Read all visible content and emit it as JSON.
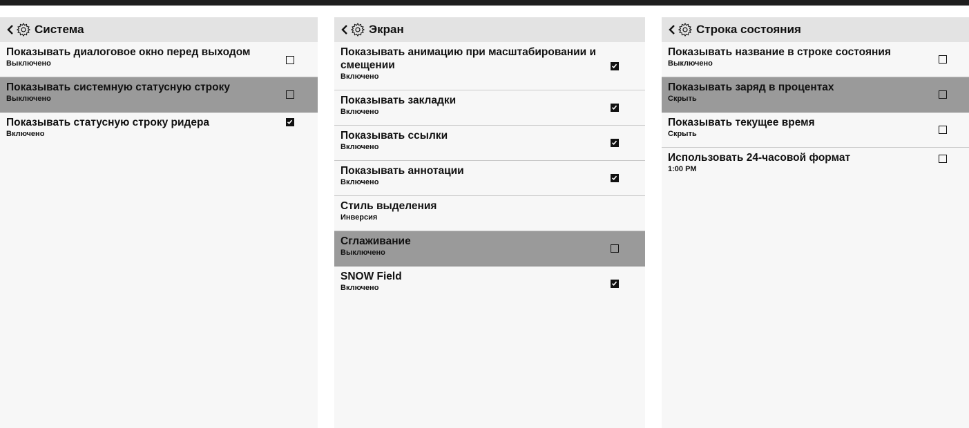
{
  "icons": {
    "back": "chevron-left-icon",
    "settings": "gear-icon",
    "checkbox_checked": "checkmark-icon"
  },
  "colors": {
    "selected_row": "#9a9a9a",
    "header_bg": "#e3e3e3",
    "panel_bg": "#f7f7f7",
    "top_bar": "#1e1e1e"
  },
  "panels": [
    {
      "title": "Система",
      "items": [
        {
          "title": "Показывать диалоговое окно перед выходом",
          "subtitle": "Выключено",
          "checked": false,
          "selected": false
        },
        {
          "title": "Показывать системную статусную строку",
          "subtitle": "Выключено",
          "checked": false,
          "selected": true
        },
        {
          "title": "Показывать статусную строку ридера",
          "subtitle": "Включено",
          "checked": true,
          "selected": false
        }
      ]
    },
    {
      "title": "Экран",
      "items": [
        {
          "title": "Показывать анимацию при масштабировании и смещении",
          "subtitle": "Включено",
          "checked": true,
          "selected": false
        },
        {
          "title": "Показывать закладки",
          "subtitle": "Включено",
          "checked": true,
          "selected": false
        },
        {
          "title": "Показывать ссылки",
          "subtitle": "Включено",
          "checked": true,
          "selected": false
        },
        {
          "title": "Показывать аннотации",
          "subtitle": "Включено",
          "checked": true,
          "selected": false
        },
        {
          "title": "Стиль выделения",
          "subtitle": "Инверсия",
          "selected": false
        },
        {
          "title": "Сглаживание",
          "subtitle": "Выключено",
          "checked": false,
          "selected": true
        },
        {
          "title": "SNOW Field",
          "subtitle": "Включено",
          "checked": true,
          "selected": false
        }
      ]
    },
    {
      "title": "Строка состояния",
      "items": [
        {
          "title": "Показывать название в строке состояния",
          "subtitle": "Выключено",
          "checked": false,
          "selected": false
        },
        {
          "title": "Показывать заряд в процентах",
          "subtitle": "Скрыть",
          "checked": false,
          "selected": true
        },
        {
          "title": "Показывать текущее время",
          "subtitle": "Скрыть",
          "checked": false,
          "selected": false
        },
        {
          "title": "Использовать 24-часовой формат",
          "subtitle": "1:00 PM",
          "checked": false,
          "selected": false
        }
      ]
    }
  ]
}
